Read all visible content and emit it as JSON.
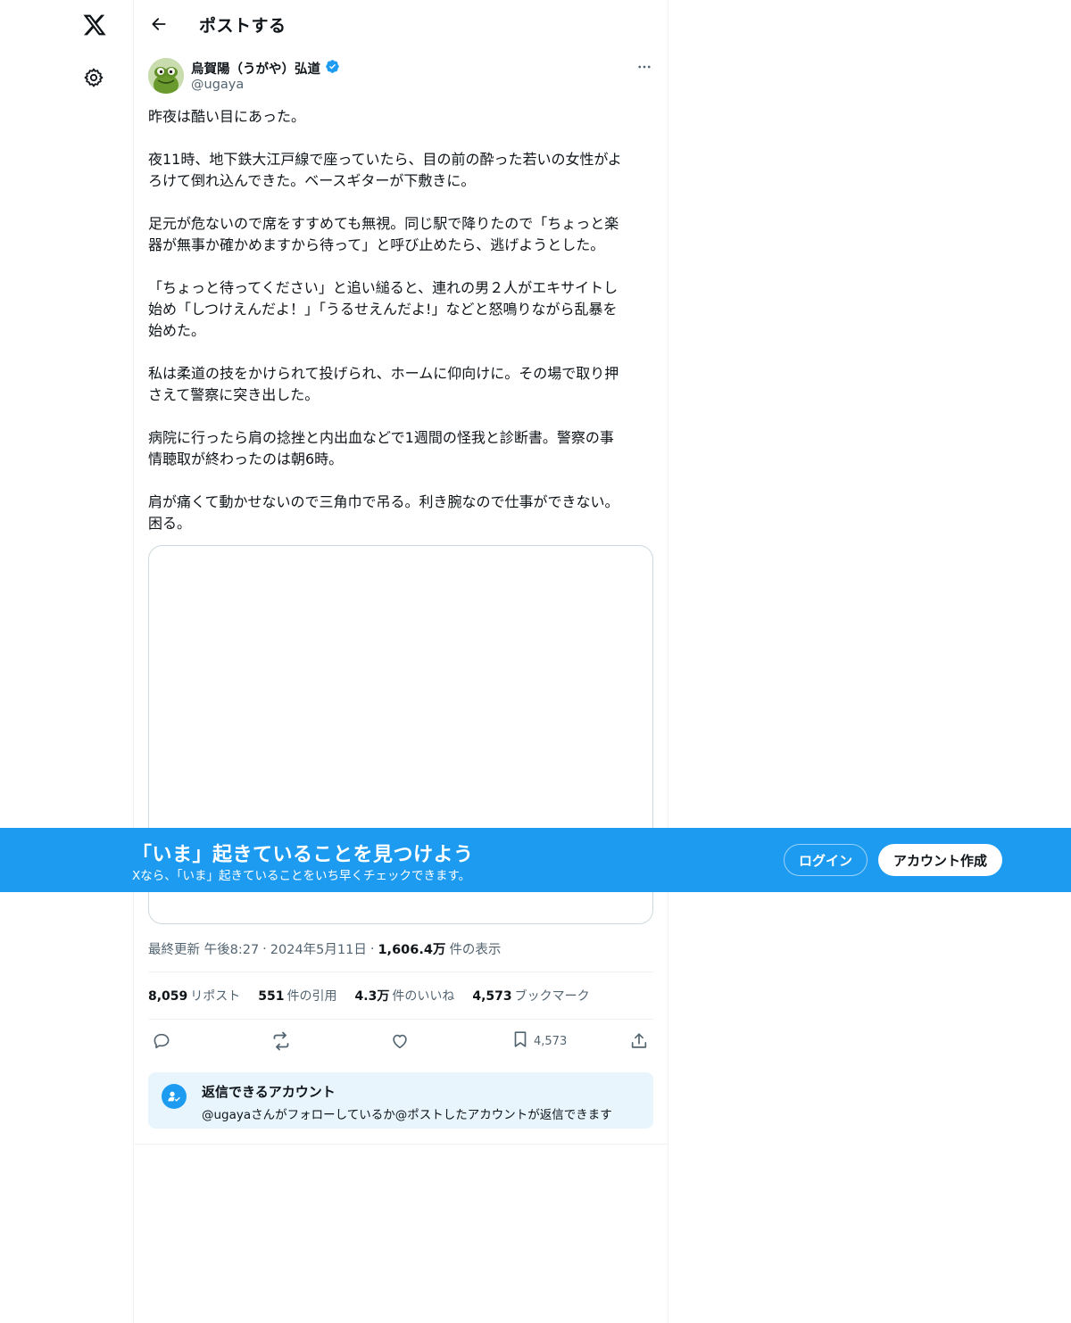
{
  "header": {
    "title": "ポストする"
  },
  "author": {
    "name": "烏賀陽（うがや）弘道",
    "handle": "@ugaya"
  },
  "post": {
    "paragraphs": [
      "昨夜は酷い目にあった。",
      "夜11時、地下鉄大江戸線で座っていたら、目の前の酔った若いの女性がよ\nろけて倒れ込んできた。ベースギターが下敷きに。",
      "足元が危ないので席をすすめても無視。同じ駅で降りたので「ちょっと楽\n器が無事か確かめますから待って」と呼び止めたら、逃げようとした。",
      "「ちょっと待ってください」と追い縋ると、連れの男２人がエキサイトし\n始め「しつけえんだよ！」「うるせえんだよ!」などと怒鳴りながら乱暴を\n始めた。",
      "私は柔道の技をかけられて投げられ、ホームに仰向けに。その場で取り押\nさえて警察に突き出した。",
      "病院に行ったら肩の捻挫と内出血などで1週間の怪我と診断書。警察の事\n情聴取が終わったのは朝6時。",
      "肩が痛くて動かせないので三角巾で吊る。利き腕なので仕事ができない。\n困る。"
    ],
    "timestamp_prefix": "最終更新 午後8:27",
    "date": "2024年5月11日",
    "dot": "·",
    "views_value": "1,606.4万",
    "views_label": "件の表示"
  },
  "stats": {
    "reposts_value": "8,059",
    "reposts_label": "リポスト",
    "quotes_value": "551",
    "quotes_label": "件の引用",
    "likes_value": "4.3万",
    "likes_label": "件のいいね",
    "bookmarks_value": "4,573",
    "bookmarks_label": "ブックマーク"
  },
  "actions": {
    "bookmark_count": "4,573"
  },
  "reply_restriction": {
    "title": "返信できるアカウント",
    "subtitle": "@ugayaさんがフォローしているか@ポストしたアカウントが返信できます"
  },
  "banner": {
    "title": "「いま」起きていることを見つけよう",
    "subtitle": "Xなら、「いま」起きていることをいち早くチェックできます。",
    "login_label": "ログイン",
    "signup_label": "アカウント作成"
  },
  "colors": {
    "accent": "#1d9bf0",
    "text": "#0f1419",
    "secondary": "#536471"
  }
}
